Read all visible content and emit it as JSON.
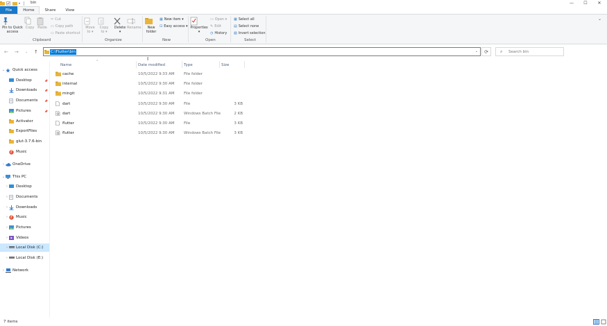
{
  "window": {
    "title": "bin",
    "controls": {
      "minimize": "—",
      "maximize": "☐",
      "close": "✕"
    }
  },
  "tabs": [
    {
      "label": "File"
    },
    {
      "label": "Home"
    },
    {
      "label": "Share"
    },
    {
      "label": "View"
    }
  ],
  "ribbon": {
    "clipboard": {
      "pin_label_1": "Pin to Quick",
      "pin_label_2": "access",
      "copy": "Copy",
      "paste": "Paste",
      "cut": "Cut",
      "copy_path": "Copy path",
      "paste_shortcut": "Paste shortcut",
      "group": "Clipboard"
    },
    "organize": {
      "move_to_1": "Move",
      "move_to_2": "to ▾",
      "copy_to_1": "Copy",
      "copy_to_2": "to ▾",
      "delete_1": "Delete",
      "delete_2": "▾",
      "rename": "Rename",
      "group": "Organize"
    },
    "new": {
      "new_folder_1": "New",
      "new_folder_2": "folder",
      "new_item": "New item ▾",
      "easy_access": "Easy access ▾",
      "group": "New"
    },
    "open": {
      "properties_1": "Properties",
      "properties_2": "▾",
      "open": "Open ▾",
      "edit": "Edit",
      "history": "History",
      "group": "Open"
    },
    "select": {
      "select_all": "Select all",
      "select_none": "Select none",
      "invert_selection": "Invert selection",
      "group": "Select"
    }
  },
  "address": {
    "path": "C:\\Flutter\\bin",
    "search_placeholder": "Search bin"
  },
  "navpane": [
    {
      "label": "Quick access",
      "icon": "star-icon",
      "level": 0,
      "chev": "⌄",
      "pin": false
    },
    {
      "label": "Desktop",
      "icon": "desktop-icon",
      "level": 1,
      "chev": "",
      "pin": true
    },
    {
      "label": "Downloads",
      "icon": "downloads-icon",
      "level": 1,
      "chev": "",
      "pin": true
    },
    {
      "label": "Documents",
      "icon": "documents-icon",
      "level": 1,
      "chev": "",
      "pin": true
    },
    {
      "label": "Pictures",
      "icon": "pictures-icon",
      "level": 1,
      "chev": "",
      "pin": true
    },
    {
      "label": "Activator",
      "icon": "folder-icon",
      "level": 1,
      "chev": "",
      "pin": false
    },
    {
      "label": "ExportFiles",
      "icon": "folder-icon",
      "level": 1,
      "chev": "",
      "pin": false
    },
    {
      "label": "glut-3.7.6-bin",
      "icon": "folder-icon",
      "level": 1,
      "chev": "",
      "pin": false
    },
    {
      "label": "Music",
      "icon": "music-icon",
      "level": 1,
      "chev": "",
      "pin": false
    },
    {
      "label": "OneDrive",
      "icon": "cloud-icon",
      "level": 0,
      "chev": "›",
      "pin": false
    },
    {
      "label": "This PC",
      "icon": "pc-icon",
      "level": 0,
      "chev": "⌄",
      "pin": false
    },
    {
      "label": "Desktop",
      "icon": "desktop-icon",
      "level": 1,
      "chev": "›",
      "pin": false
    },
    {
      "label": "Documents",
      "icon": "documents-icon",
      "level": 1,
      "chev": "›",
      "pin": false
    },
    {
      "label": "Downloads",
      "icon": "downloads-icon",
      "level": 1,
      "chev": "›",
      "pin": false
    },
    {
      "label": "Music",
      "icon": "music-icon",
      "level": 1,
      "chev": "›",
      "pin": false
    },
    {
      "label": "Pictures",
      "icon": "pictures-icon",
      "level": 1,
      "chev": "›",
      "pin": false
    },
    {
      "label": "Videos",
      "icon": "videos-icon",
      "level": 1,
      "chev": "›",
      "pin": false
    },
    {
      "label": "Local Disk (C:)",
      "icon": "drive-icon",
      "level": 1,
      "chev": "›",
      "pin": false,
      "selected": true
    },
    {
      "label": "Local Disk (E:)",
      "icon": "drive-icon",
      "level": 1,
      "chev": "›",
      "pin": false
    },
    {
      "label": "Network",
      "icon": "network-icon",
      "level": 0,
      "chev": "›",
      "pin": false
    }
  ],
  "columns": {
    "name": "Name",
    "date": "Date modified",
    "type": "Type",
    "size": "Size"
  },
  "files": [
    {
      "name": "cache",
      "date": "10/5/2022 9:33 AM",
      "type": "File folder",
      "size": "",
      "icon": "folder-icon"
    },
    {
      "name": "internal",
      "date": "10/5/2022 9:30 AM",
      "type": "File folder",
      "size": "",
      "icon": "folder-icon"
    },
    {
      "name": "mingit",
      "date": "10/5/2022 9:31 AM",
      "type": "File folder",
      "size": "",
      "icon": "folder-icon"
    },
    {
      "name": "dart",
      "date": "10/5/2022 9:30 AM",
      "type": "File",
      "size": "3 KB",
      "icon": "file-icon"
    },
    {
      "name": "dart",
      "date": "10/5/2022 9:30 AM",
      "type": "Windows Batch File",
      "size": "2 KB",
      "icon": "batch-file-icon"
    },
    {
      "name": "flutter",
      "date": "10/5/2022 9:30 AM",
      "type": "File",
      "size": "3 KB",
      "icon": "file-icon"
    },
    {
      "name": "flutter",
      "date": "10/5/2022 9:30 AM",
      "type": "Windows Batch File",
      "size": "3 KB",
      "icon": "batch-file-icon"
    }
  ],
  "status": {
    "count": "7 items"
  },
  "colors": {
    "accent": "#1979ca",
    "folder": "#e8b53a",
    "selection": "#0078d7",
    "nav_selected": "#cce8ff"
  }
}
